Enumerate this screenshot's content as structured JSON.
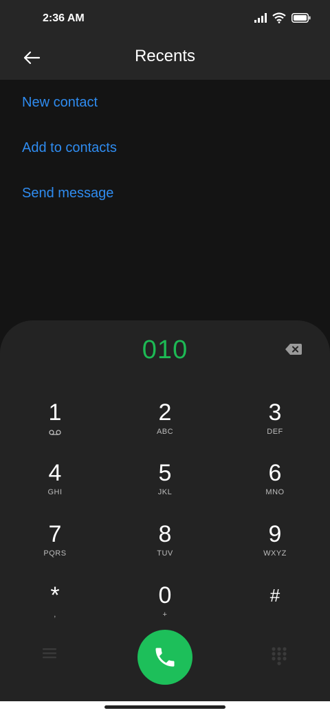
{
  "status_bar": {
    "time": "2:36 AM"
  },
  "header": {
    "title": "Recents"
  },
  "actions": [
    "New contact",
    "Add to contacts",
    "Send message"
  ],
  "dialer": {
    "number": "010",
    "keys": [
      {
        "digit": "1",
        "letters": ""
      },
      {
        "digit": "2",
        "letters": "ABC"
      },
      {
        "digit": "3",
        "letters": "DEF"
      },
      {
        "digit": "4",
        "letters": "GHI"
      },
      {
        "digit": "5",
        "letters": "JKL"
      },
      {
        "digit": "6",
        "letters": "MNO"
      },
      {
        "digit": "7",
        "letters": "PQRS"
      },
      {
        "digit": "8",
        "letters": "TUV"
      },
      {
        "digit": "9",
        "letters": "WXYZ"
      },
      {
        "digit": "*",
        "letters": ","
      },
      {
        "digit": "0",
        "letters": "+"
      },
      {
        "digit": "#",
        "letters": ""
      }
    ]
  },
  "colors": {
    "accent_link": "#2f8cf0",
    "number": "#1db954",
    "call": "#1dbf5a"
  },
  "icons": [
    "back-arrow-icon",
    "signal-icon",
    "wifi-icon",
    "battery-icon",
    "backspace-icon",
    "voicemail-icon",
    "menu-icon",
    "phone-icon",
    "dialpad-icon"
  ]
}
